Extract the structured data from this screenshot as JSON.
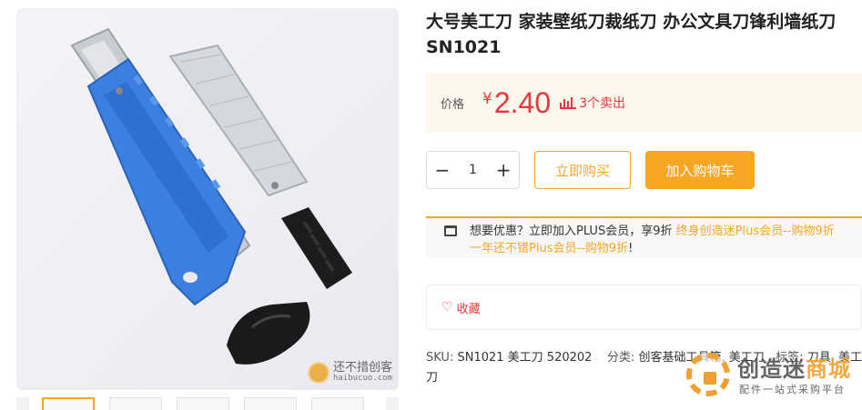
{
  "product": {
    "title": "大号美工刀 家装壁纸刀裁纸刀 办公文具刀锋利墙纸刀 SN1021"
  },
  "price": {
    "label": "价格",
    "currency": "¥",
    "value": "2.40",
    "sold": "3个卖出"
  },
  "quantity": {
    "minus": "−",
    "value": "1",
    "plus": "+"
  },
  "actions": {
    "buy_now": "立即购买",
    "add_to_cart": "加入购物车"
  },
  "plus_promo": {
    "text": "想要优惠？立即加入PLUS会员，享9折",
    "link1": "终身创造迷Plus会员--购物9折",
    "link2": "一年还不错Plus会员--购物9折",
    "suffix": "!"
  },
  "favorite": {
    "label": "收藏"
  },
  "meta": {
    "sku_label": "SKU:",
    "sku_value": "SN1021 美工刀 520202",
    "category_label": "分类:",
    "category_value": "创客基础工具箱, 美工刀",
    "tags_label": "标签:",
    "tags_value": "刀具, 美工刀"
  },
  "image_watermark": {
    "cn": "还不措创客",
    "en": "haibucuo.com"
  },
  "site_watermark": {
    "name_part1": "创造迷",
    "name_part2": "商城",
    "subtitle": "配件一站式采购平台"
  },
  "colors": {
    "accent": "#f5a623",
    "price": "#e4393c",
    "knife_blue": "#3b7fe0"
  }
}
